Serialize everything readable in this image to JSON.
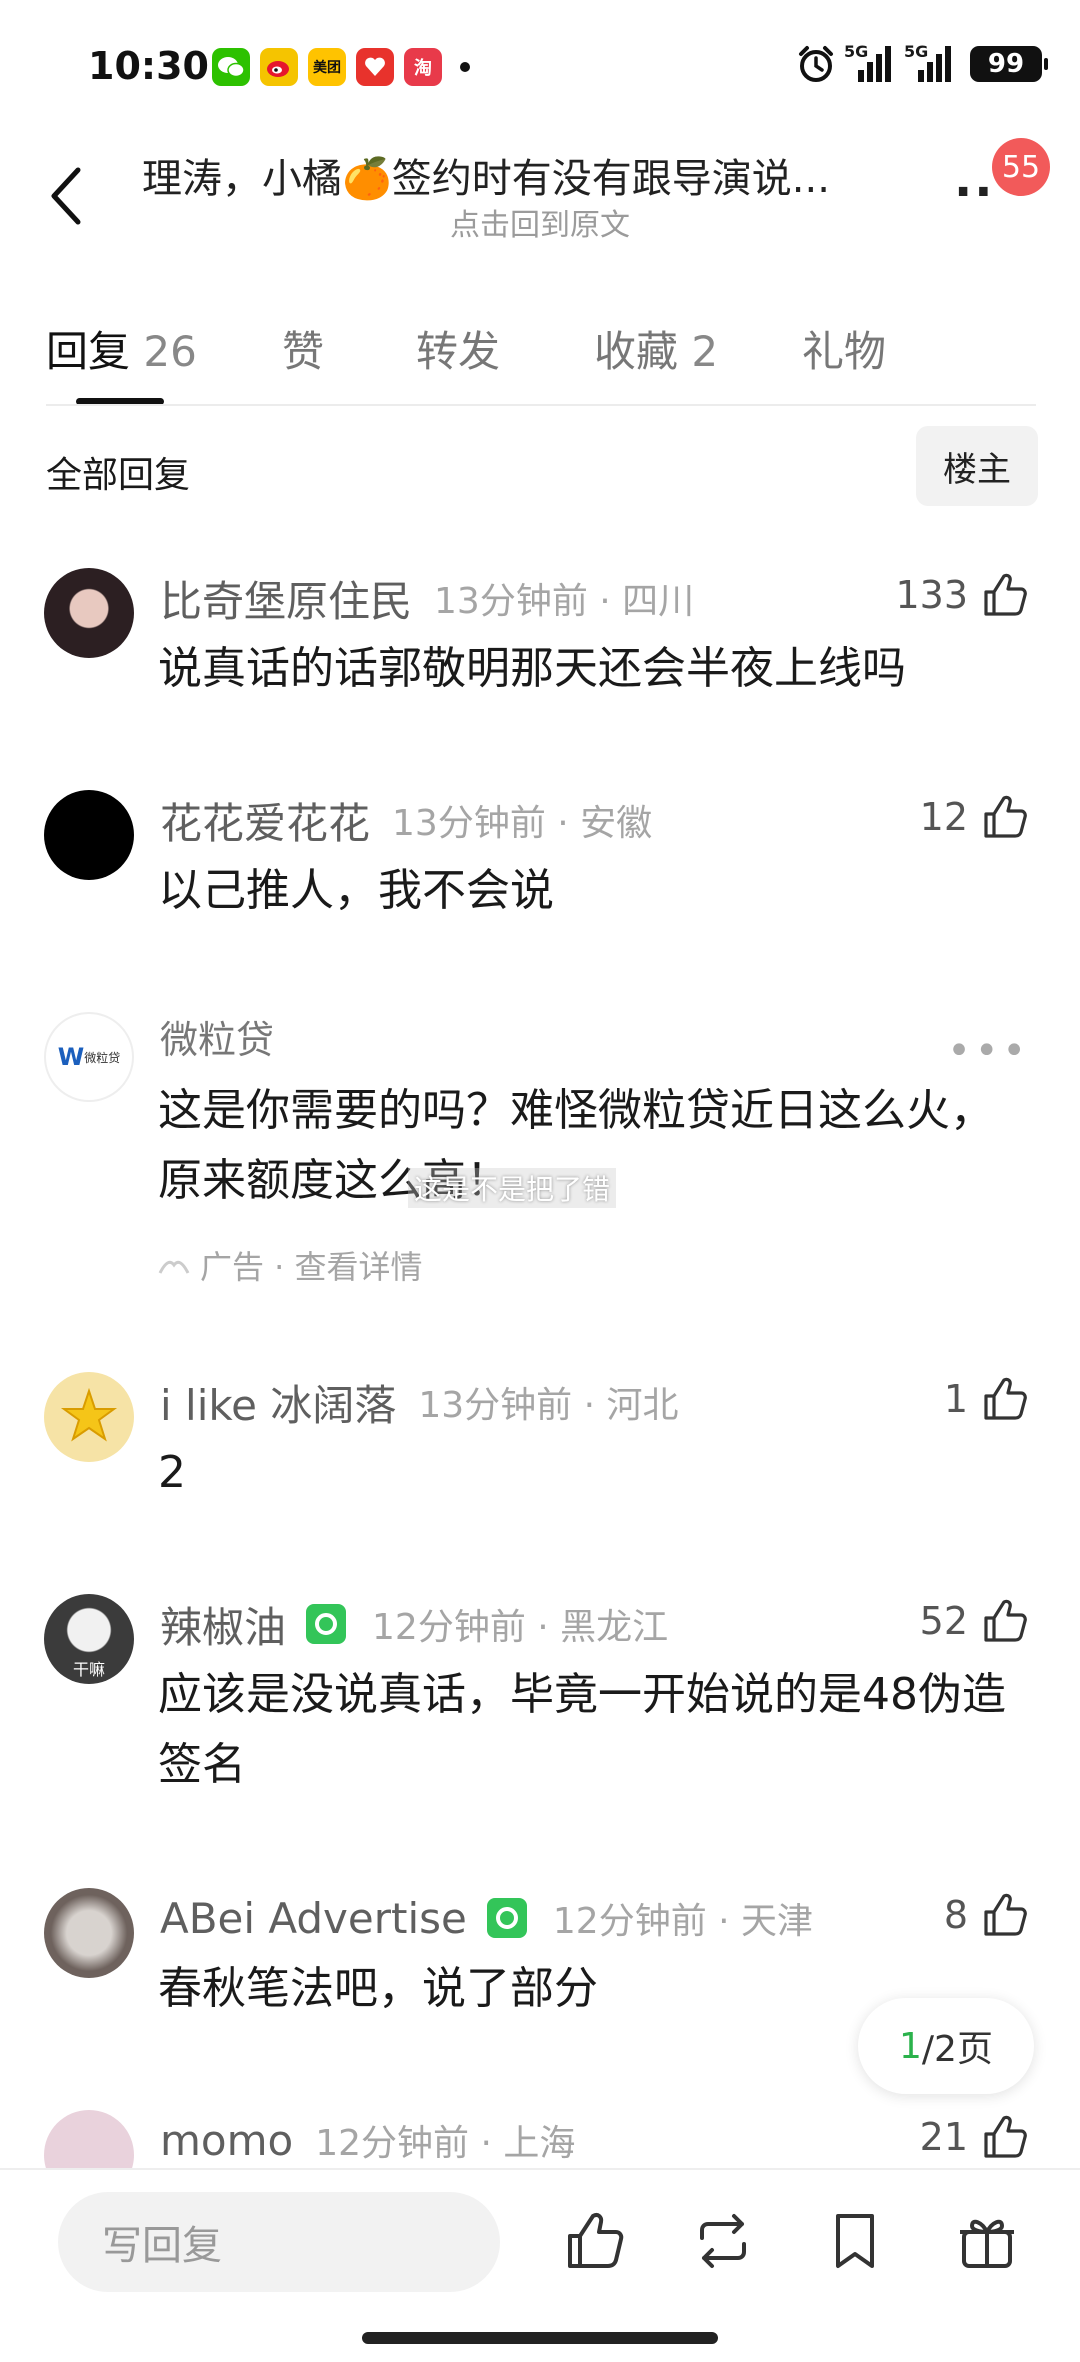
{
  "status_bar": {
    "time": "10:30",
    "app_icons": [
      {
        "name": "wechat-icon",
        "color": "#2dc100",
        "glyph": ""
      },
      {
        "name": "weibo-icon",
        "color": "#f5c400",
        "glyph": ""
      },
      {
        "name": "meituan-icon",
        "color": "#ffc300",
        "glyph": "美团"
      },
      {
        "name": "shopping-app-icon",
        "color": "#e8322c",
        "glyph": ""
      },
      {
        "name": "taobao-icon",
        "color": "#e83a4a",
        "glyph": "淘"
      }
    ],
    "signal1_label": "5G",
    "signal2_label": "5G",
    "battery": "99"
  },
  "header": {
    "title": "理涛，小橘🍊签约时有没有跟导演说...",
    "subtitle": "点击回到原文",
    "notification_count": "55"
  },
  "tabs": [
    {
      "label": "回复",
      "count": "26",
      "active": true
    },
    {
      "label": "赞",
      "count": "",
      "active": false
    },
    {
      "label": "转发",
      "count": "",
      "active": false
    },
    {
      "label": "收藏",
      "count": "2",
      "active": false
    },
    {
      "label": "礼物",
      "count": "",
      "active": false
    }
  ],
  "filter": {
    "label": "全部回复",
    "owner_button": "楼主"
  },
  "comments": [
    {
      "name": "比奇堡原住民",
      "meta": "13分钟前 · 四川",
      "likes": "133",
      "text": "说真话的话郭敬明那天还会半夜上线吗",
      "verified": false,
      "avatar_color": "#3a2a2a"
    },
    {
      "name": "花花爱花花",
      "meta": "13分钟前 · 安徽",
      "likes": "12",
      "text": "以己推人，我不会说",
      "verified": false,
      "avatar_color": "#000000"
    },
    {
      "name": "i like 冰阔落",
      "meta": "13分钟前 · 河北",
      "likes": "1",
      "text": "2",
      "verified": false,
      "avatar_color": "#f3d67a"
    },
    {
      "name": "辣椒油",
      "meta": "12分钟前 · 黑龙江",
      "likes": "52",
      "text": "应该是没说真话，毕竟一开始说的是48伪造签名",
      "verified": true,
      "avatar_color": "#2b2b2b",
      "avatar_text": "干嘛"
    },
    {
      "name": "ABei Advertise",
      "meta": "12分钟前 · 天津",
      "likes": "8",
      "text": "春秋笔法吧，说了部分",
      "verified": true,
      "avatar_color": "#9a8f88"
    },
    {
      "name": "momo",
      "meta": "12分钟前 · 上海",
      "likes": "21",
      "text": "",
      "verified": false,
      "avatar_color": "#e9d2dc"
    }
  ],
  "ad": {
    "name": "微粒贷",
    "avatar_text": "微粒贷",
    "text": "这是你需要的吗？难怪微粒贷近日这么火，原来额度这么高！",
    "overlay_text": "这是不是把了错",
    "meta": "广告 · 查看详情"
  },
  "pagination": {
    "current": "1",
    "total": "/2页"
  },
  "bottom_bar": {
    "reply_placeholder": "写回复"
  },
  "colors": {
    "accent_green": "#2bb24c",
    "badge_red": "#f25a5a"
  }
}
